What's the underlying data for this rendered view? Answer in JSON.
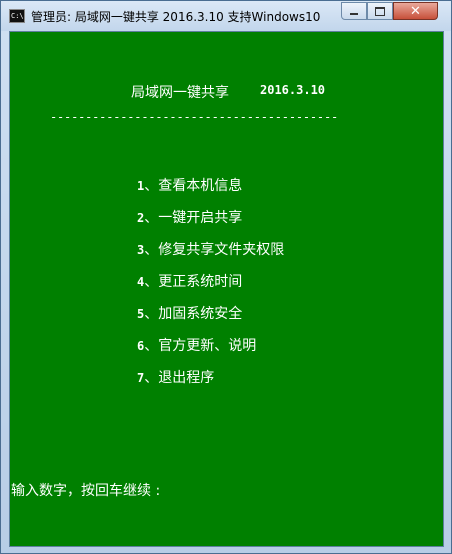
{
  "window": {
    "icon_text": "C:\\",
    "title": "管理员:  局域网一键共享 2016.3.10  支持Windows10",
    "controls": {
      "minimize": "—",
      "maximize": "□",
      "close": "✕"
    }
  },
  "console": {
    "header": {
      "title": "局域网一键共享",
      "version": "2016.3.10"
    },
    "divider": "-----------------------------------------",
    "menu": [
      {
        "num": "1",
        "label": "、查看本机信息"
      },
      {
        "num": "2",
        "label": "、一键开启共享"
      },
      {
        "num": "3",
        "label": "、修复共享文件夹权限"
      },
      {
        "num": "4",
        "label": "、更正系统时间"
      },
      {
        "num": "5",
        "label": "、加固系统安全"
      },
      {
        "num": "6",
        "label": "、官方更新、说明"
      },
      {
        "num": "7",
        "label": "、退出程序"
      }
    ],
    "prompt": "输入数字，按回车继续 :"
  }
}
